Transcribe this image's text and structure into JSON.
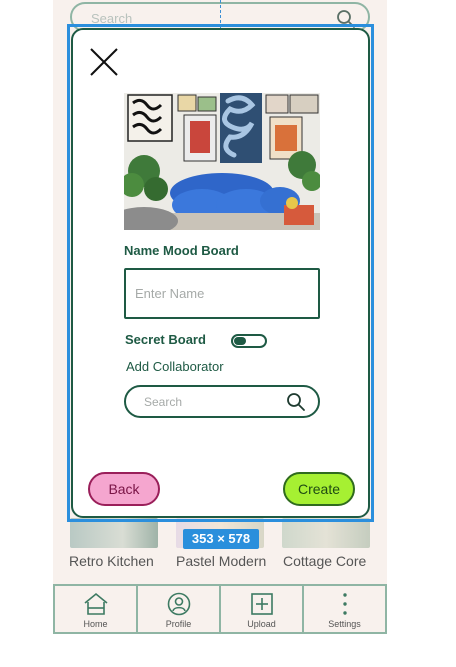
{
  "background": {
    "search": {
      "placeholder": "Search"
    },
    "boards": [
      {
        "caption": "Retro Kitchen"
      },
      {
        "caption": "Pastel Modern"
      },
      {
        "caption": "Cottage Core"
      }
    ],
    "tabs": [
      {
        "label": "Home",
        "icon": "home-icon"
      },
      {
        "label": "Profile",
        "icon": "profile-icon"
      },
      {
        "label": "Upload",
        "icon": "upload-icon"
      },
      {
        "label": "Settings",
        "icon": "more-vertical-icon"
      }
    ]
  },
  "modal": {
    "close_icon": "close-icon",
    "image": "living room with blue sofa, plants and framed art",
    "name_label": "Name Mood Board",
    "name_placeholder": "Enter Name",
    "name_value": "",
    "secret_label": "Secret Board",
    "secret_on": false,
    "collaborator_label": "Add Collaborator",
    "collaborator_search_placeholder": "Search",
    "back_label": "Back",
    "create_label": "Create"
  },
  "selection_badge": "353 × 578",
  "colors": {
    "primary": "#1e5a44",
    "background": "#f8f1ed",
    "tab_border": "#8fb5a4",
    "back_button": "#f5a6cf",
    "create_button": "#a6f032",
    "selection": "#2b8fdd"
  }
}
